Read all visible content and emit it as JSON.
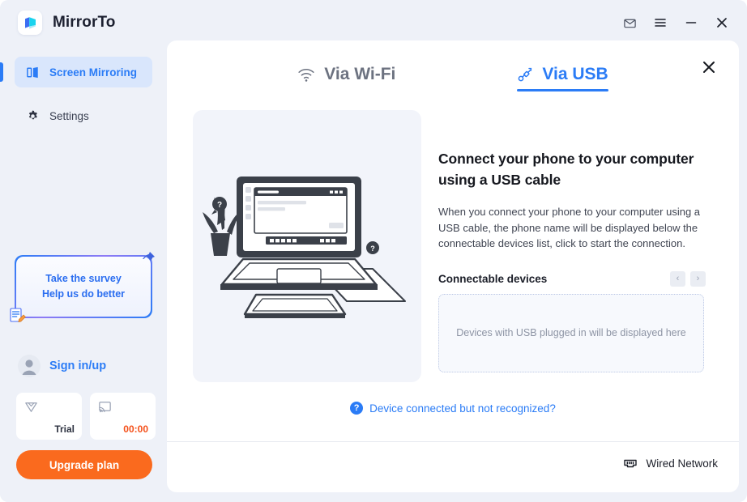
{
  "window": {
    "app_title": "MirrorTo",
    "logo_icon": "mirrorto-logo-icon",
    "controls": [
      {
        "name": "mail-icon",
        "label": "Mail"
      },
      {
        "name": "menu-icon",
        "label": "Menu"
      },
      {
        "name": "minimize-icon",
        "label": "Minimize"
      },
      {
        "name": "close-icon",
        "label": "Close"
      }
    ],
    "accent_color": "#2b7cf6",
    "sidebar_bg": "#eef1f8",
    "panel_bg": "#ffffff"
  },
  "sidebar": {
    "items": [
      {
        "label": "Screen Mirroring",
        "icon": "screen-mirroring-icon",
        "active": true
      },
      {
        "label": "Settings",
        "icon": "gear-icon",
        "active": false
      }
    ],
    "survey": {
      "line1": "Take the survey",
      "line2": "Help us do better",
      "pin_icon": "pushpin-icon",
      "doc_icon": "document-pencil-icon"
    },
    "account": {
      "sign_in_label": "Sign in/up",
      "avatar_icon": "user-avatar-icon"
    },
    "status_cards": [
      {
        "icon": "diamond-icon",
        "value": "Trial",
        "color": "#2d3240"
      },
      {
        "icon": "cast-screen-icon",
        "value": "00:00",
        "color": "#f4501a"
      }
    ],
    "upgrade_label": "Upgrade plan",
    "upgrade_color": "#fa6a1e"
  },
  "panel": {
    "close_icon": "close-icon",
    "tabs": [
      {
        "label": "Via Wi-Fi",
        "icon": "wifi-icon",
        "active": false
      },
      {
        "label": "Via USB",
        "icon": "usb-cable-icon",
        "active": true
      }
    ],
    "illustration": "laptop-tablet-usb-illustration",
    "heading": "Connect your phone to your computer using a USB cable",
    "body": "When you connect your phone to your computer using a USB cable, the phone name will be displayed below the connectable devices list, click to start the connection.",
    "devices": {
      "title": "Connectable devices",
      "prev_icon": "chevron-left-icon",
      "next_icon": "chevron-right-icon",
      "prev_label": "‹",
      "next_label": "›",
      "empty_text": "Devices with USB plugged in will be displayed here"
    },
    "help_link": {
      "badge": "?",
      "text": "Device connected but not recognized?"
    },
    "footer": {
      "network_label": "Wired Network",
      "network_icon": "ethernet-port-icon"
    }
  }
}
